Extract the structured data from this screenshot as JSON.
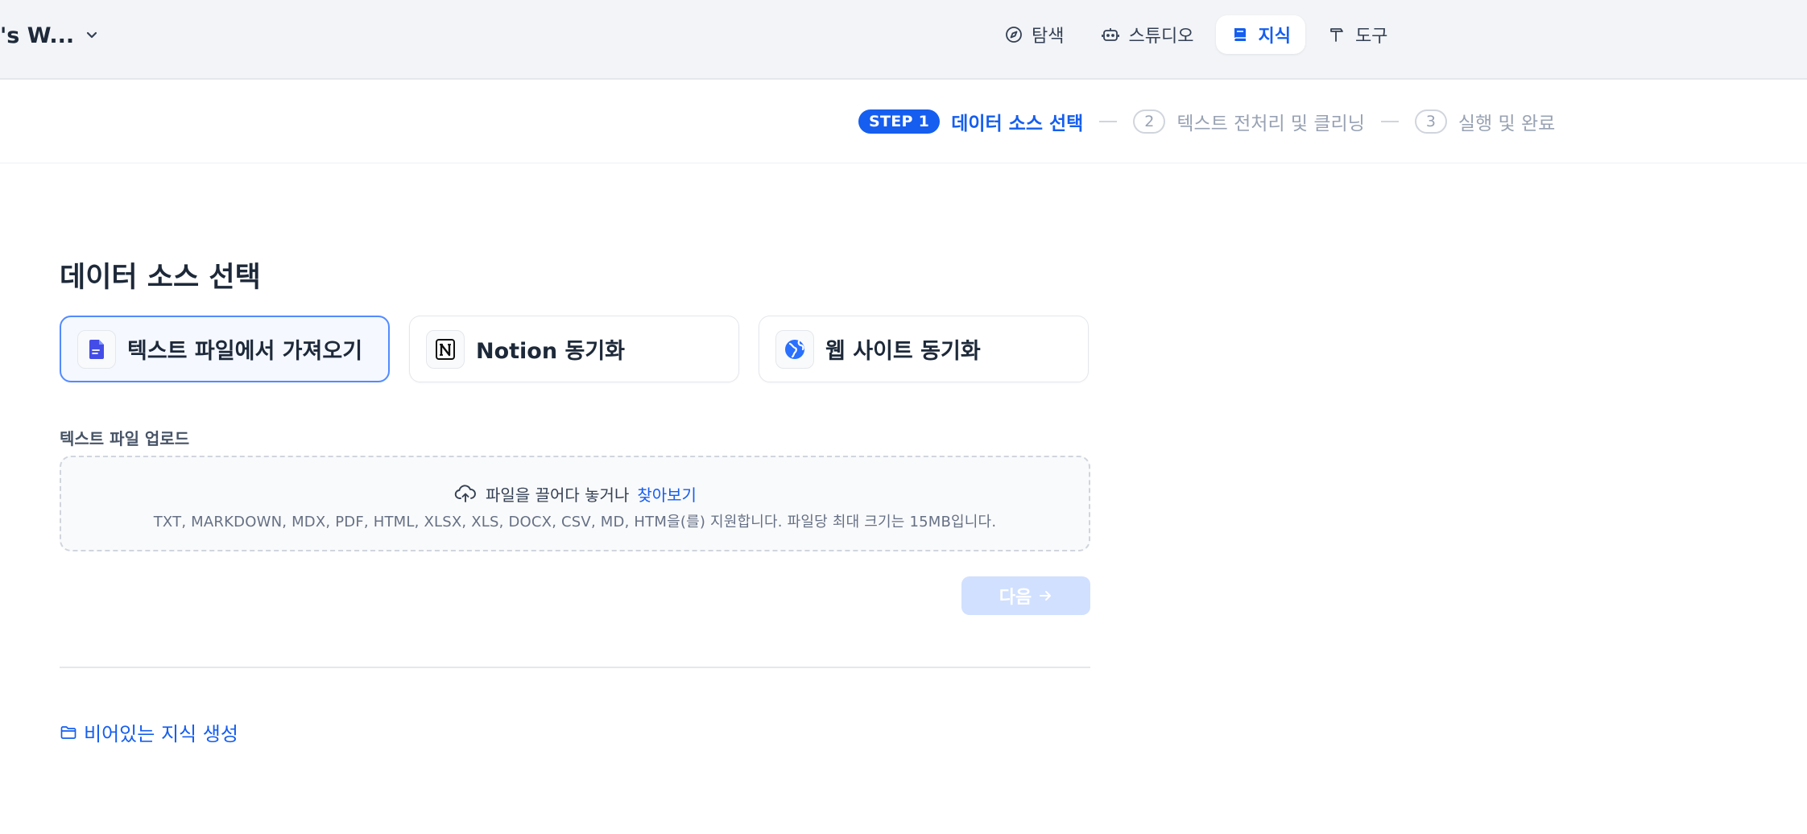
{
  "header": {
    "workspace_name": "'s W...",
    "nav": [
      {
        "label": "탐색",
        "icon": "compass-icon"
      },
      {
        "label": "스튜디오",
        "icon": "robot-icon"
      },
      {
        "label": "지식",
        "icon": "book-icon",
        "active": true
      },
      {
        "label": "도구",
        "icon": "hammer-icon"
      }
    ]
  },
  "stepper": {
    "active_badge": "STEP 1",
    "active_label": "데이터 소스 선택",
    "steps": [
      {
        "num": "2",
        "label": "텍스트 전처리 및 클리닝"
      },
      {
        "num": "3",
        "label": "실행 및 완료"
      }
    ]
  },
  "main": {
    "title": "데이터 소스 선택",
    "sources": [
      {
        "label": "텍스트 파일에서 가져오기",
        "icon": "file-icon",
        "selected": true
      },
      {
        "label": "Notion 동기화",
        "icon": "notion-icon"
      },
      {
        "label": "웹 사이트 동기화",
        "icon": "globe-icon"
      }
    ],
    "upload": {
      "label": "텍스트 파일 업로드",
      "drop_text": "파일을 끌어다 놓거나",
      "browse_text": "찾아보기",
      "hint": "TXT, MARKDOWN, MDX, PDF, HTML, XLSX, XLS, DOCX, CSV, MD, HTM을(를) 지원합니다. 파일당 최대 크기는 15MB입니다."
    },
    "next_label": "다음",
    "empty_knowledge_label": "비어있는 지식 생성"
  },
  "colors": {
    "accent": "#155eef",
    "header_bg": "#f2f4f7",
    "disabled_button": "#d1e0ff"
  }
}
